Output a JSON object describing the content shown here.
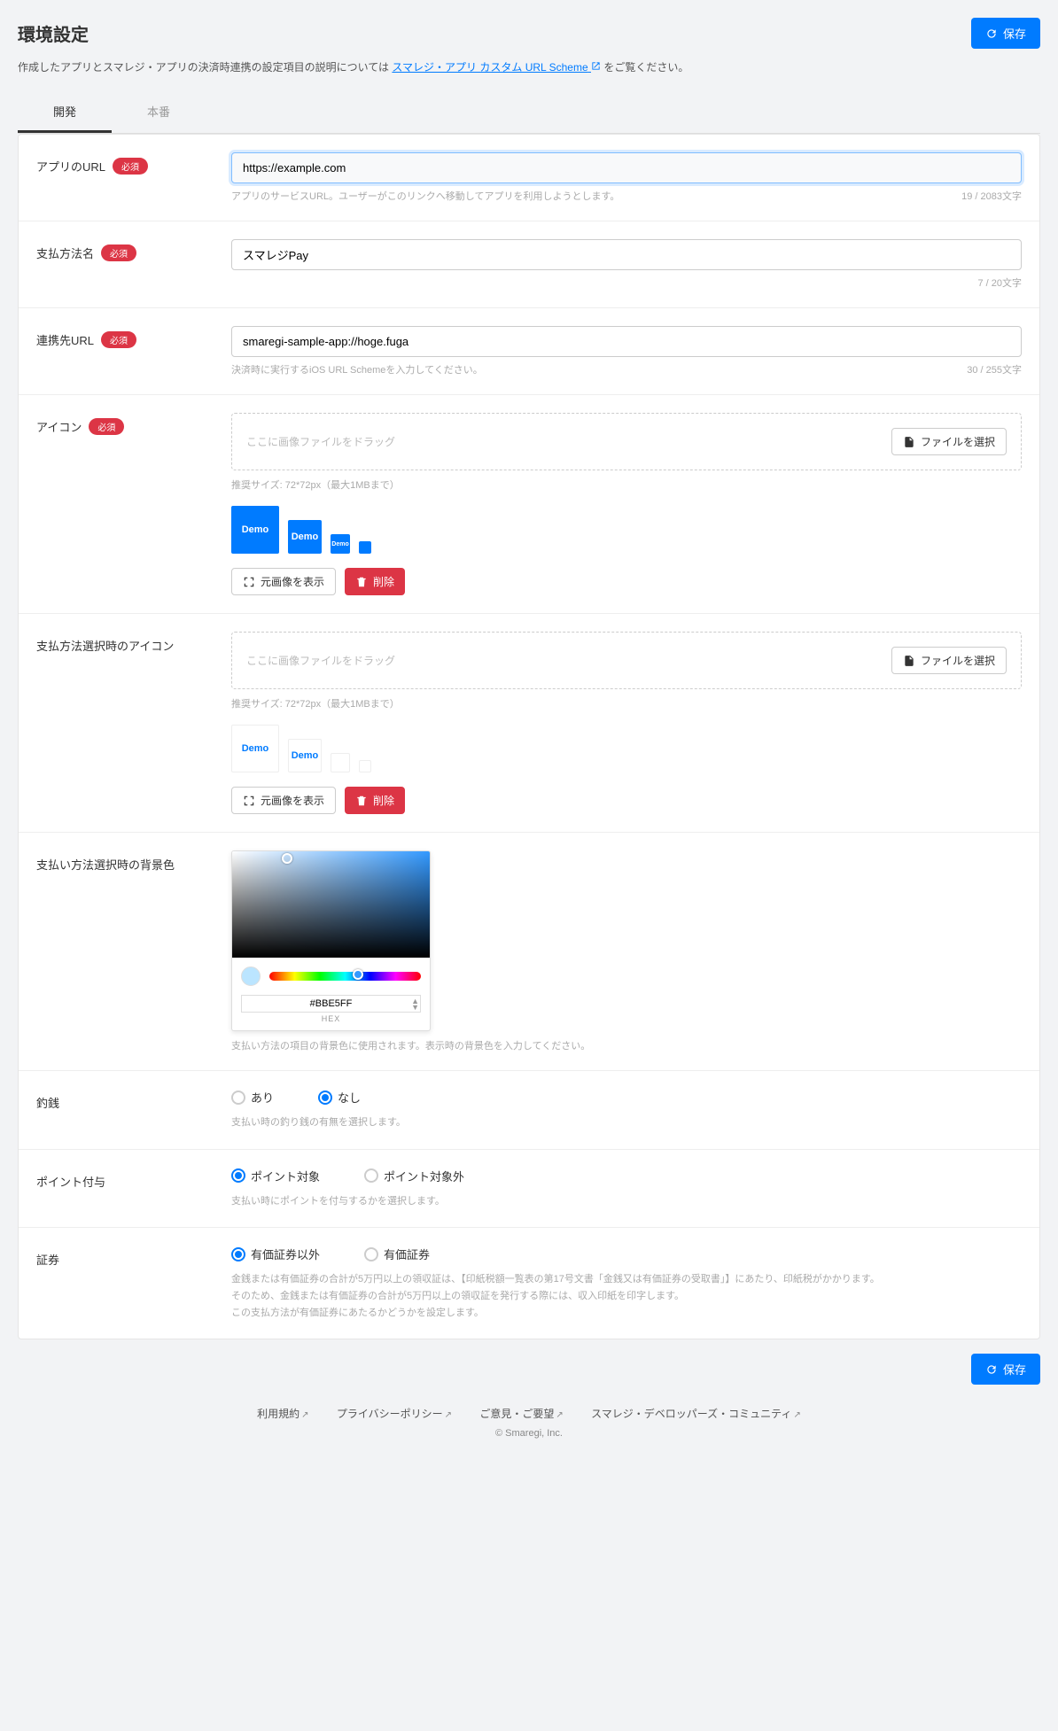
{
  "page_title": "環境設定",
  "save_btn": "保存",
  "desc_prefix": "作成したアプリとスマレジ・アプリの決済時連携の設定項目の説明については",
  "desc_link": "スマレジ・アプリ カスタム URL Scheme",
  "desc_suffix": "をご覧ください。",
  "tabs": {
    "dev": "開発",
    "prod": "本番"
  },
  "required": "必須",
  "fields": {
    "app_url": {
      "label": "アプリのURL",
      "value": "https://example.com",
      "help": "アプリのサービスURL。ユーザーがこのリンクへ移動してアプリを利用しようとします。",
      "count": "19 / 2083文字"
    },
    "pay_name": {
      "label": "支払方法名",
      "value": "スマレジPay",
      "count": "7 / 20文字"
    },
    "link_url": {
      "label": "連携先URL",
      "value": "smaregi-sample-app://hoge.fuga",
      "help": "決済時に実行するiOS URL Schemeを入力してください。",
      "count": "30 / 255文字"
    },
    "icon": {
      "label": "アイコン",
      "drop_hint": "ここに画像ファイルをドラッグ",
      "file_btn": "ファイルを選択",
      "size_hint": "推奨サイズ: 72*72px（最大1MBまで）",
      "demo": "Demo",
      "view_orig": "元画像を表示",
      "delete": "削除"
    },
    "select_icon": {
      "label": "支払方法選択時のアイコン"
    },
    "bgcolor": {
      "label": "支払い方法選択時の背景色",
      "hex": "#BBE5FF",
      "hex_label": "HEX",
      "help": "支払い方法の項目の背景色に使用されます。表示時の背景色を入力してください。"
    },
    "change": {
      "label": "釣銭",
      "opt_yes": "あり",
      "opt_no": "なし",
      "help": "支払い時の釣り銭の有無を選択します。"
    },
    "point": {
      "label": "ポイント付与",
      "opt_on": "ポイント対象",
      "opt_off": "ポイント対象外",
      "help": "支払い時にポイントを付与するかを選択します。"
    },
    "security": {
      "label": "証券",
      "opt_other": "有価証券以外",
      "opt_sec": "有価証券",
      "help1": "金銭または有価証券の合計が5万円以上の領収証は、【印紙税額一覧表の第17号文書「金銭又は有価証券の受取書」】にあたり、印紙税がかかります。",
      "help2": "そのため、金銭または有価証券の合計が5万円以上の領収証を発行する際には、収入印紙を印字します。",
      "help3": "この支払方法が有価証券にあたるかどうかを設定します。"
    }
  },
  "footer": {
    "terms": "利用規約",
    "privacy": "プライバシーポリシー",
    "feedback": "ご意見・ご要望",
    "community": "スマレジ・デベロッパーズ・コミュニティ",
    "copyright": "© Smaregi, Inc."
  }
}
